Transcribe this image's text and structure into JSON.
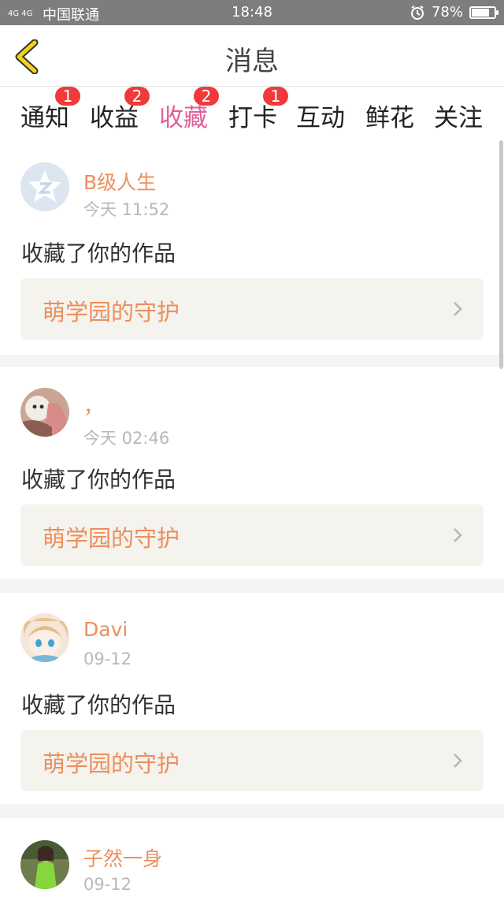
{
  "status": {
    "carrier": "中国联通",
    "signal": "4G 4G",
    "time": "18:48",
    "battery": "78%",
    "battery_level": 0.78
  },
  "header": {
    "title": "消息"
  },
  "tabs": [
    {
      "label": "通知",
      "badge": "1"
    },
    {
      "label": "收益",
      "badge": "2"
    },
    {
      "label": "收藏",
      "badge": "2"
    },
    {
      "label": "打卡",
      "badge": "1"
    },
    {
      "label": "互动",
      "badge": ""
    },
    {
      "label": "鲜花",
      "badge": ""
    },
    {
      "label": "关注",
      "badge": ""
    }
  ],
  "messages": [
    {
      "user": "B级人生",
      "time": "今天 11:52",
      "action": "收藏了你的作品",
      "work": "萌学园的守护"
    },
    {
      "user": "，",
      "time": "今天 02:46",
      "action": "收藏了你的作品",
      "work": "萌学园的守护"
    },
    {
      "user": "Davi",
      "time": "09-12",
      "action": "收藏了你的作品",
      "work": "萌学园的守护"
    },
    {
      "user": "子然一身",
      "time": "09-12",
      "action": "",
      "work": ""
    }
  ],
  "colors": {
    "accent_pink": "#e0609a",
    "accent_orange": "#ec8f5c",
    "badge_red": "#f03a3a",
    "back_yellow": "#f2d21a"
  }
}
